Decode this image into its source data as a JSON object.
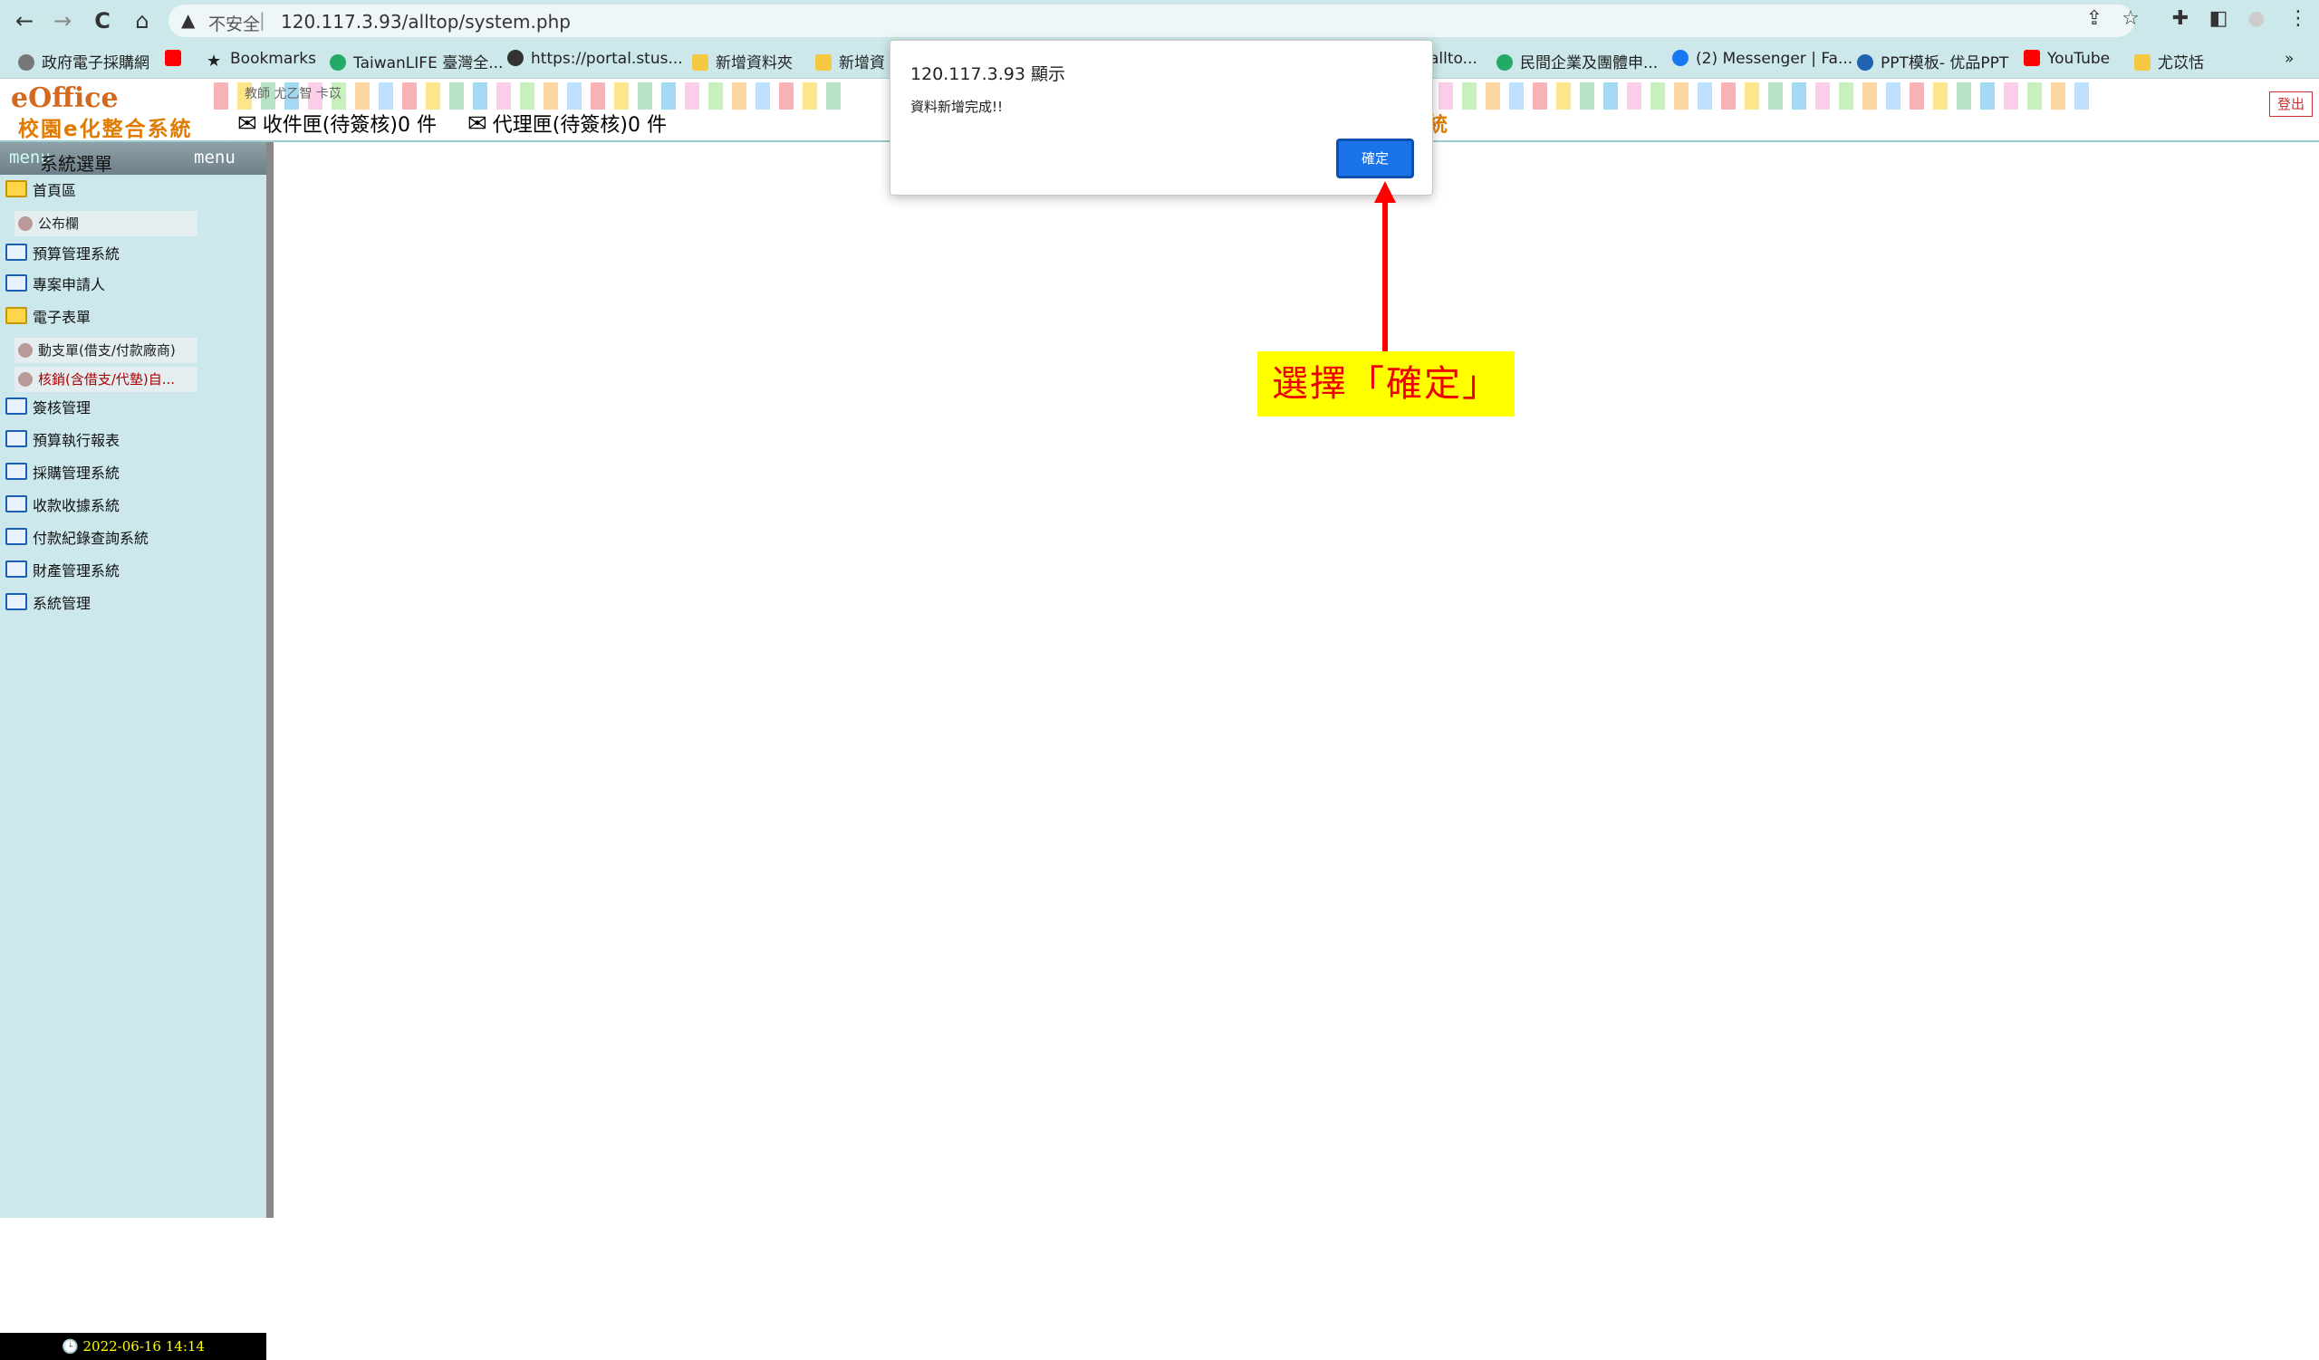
{
  "browser": {
    "back_icon": "←",
    "forward_icon": "→",
    "reload_icon": "C",
    "home_icon": "⌂",
    "security_warning_icon": "▲",
    "insecure_label": "不安全",
    "separator": "|",
    "url": "120.117.3.93/alltop/system.php",
    "icons": [
      "share-icon",
      "star-icon",
      "extensions-icon",
      "sidepanel-icon",
      "profile-icon",
      "menu-icon"
    ]
  },
  "bookmarks": [
    {
      "label": "政府電子採購網",
      "icon": "globe-icon",
      "color": "#777"
    },
    {
      "label": "",
      "icon": "youtube-icon",
      "color": "#f00"
    },
    {
      "label": "Bookmarks",
      "icon": "star-icon",
      "color": "#222"
    },
    {
      "label": "TaiwanLIFE 臺灣全...",
      "icon": "tl-icon",
      "color": "#2a6"
    },
    {
      "label": "https://portal.stus...",
      "icon": "globe-icon",
      "color": "#333"
    },
    {
      "label": "新增資料夾",
      "icon": "folder-icon",
      "color": "#f5c842"
    },
    {
      "label": "新增資",
      "icon": "folder-icon",
      "color": "#f5c842"
    },
    {
      "label": "allto...",
      "icon": "",
      "color": "#000"
    },
    {
      "label": "民間企業及團體申...",
      "icon": "leaf-icon",
      "color": "#2a6"
    },
    {
      "label": "(2) Messenger | Fa...",
      "icon": "facebook-icon",
      "color": "#1877f2"
    },
    {
      "label": "PPT模板- 优品PPT",
      "icon": "ppt-icon",
      "color": "#1e62b0"
    },
    {
      "label": "YouTube",
      "icon": "youtube-icon",
      "color": "#f00"
    },
    {
      "label": "尤苡恬",
      "icon": "folder-icon",
      "color": "#f5c842"
    },
    {
      "label": "»",
      "icon": "",
      "color": "#222"
    }
  ],
  "app": {
    "logo_main": "eOffice",
    "logo_sub": "校園e化整合系統",
    "user_tag": "教師 尤乙智 卡苡",
    "inbox_label": "收件匣(待簽核)0 件",
    "proxy_label": "代理匣(待簽核)0 件",
    "overlap_char": "統",
    "logout_label": "登出",
    "strip_colors": [
      "#f8b4b4",
      "#fde68a",
      "#b7e4c7",
      "#a5d8f3",
      "#fbcfe8",
      "#c7f0bd",
      "#ffd6a5",
      "#bde0fe"
    ]
  },
  "sidebar": {
    "header_ghost": "menu",
    "title": "系統選單",
    "menu_label": "menu",
    "items": [
      {
        "label": "首頁區",
        "type": "folder",
        "open": true
      },
      {
        "label": "公布欄",
        "type": "sub",
        "red": false
      },
      {
        "label": "預算管理系統",
        "type": "folder",
        "open": false
      },
      {
        "label": "專案申請人",
        "type": "folder",
        "open": false
      },
      {
        "label": "電子表單",
        "type": "folder",
        "open": true
      },
      {
        "label": "動支單(借支/付款廠商)",
        "type": "sub",
        "red": false
      },
      {
        "label": "核銷(含借支/代墊)自...",
        "type": "sub",
        "red": true
      },
      {
        "label": "簽核管理",
        "type": "folder",
        "open": false
      },
      {
        "label": "預算執行報表",
        "type": "folder",
        "open": false
      },
      {
        "label": "採購管理系統",
        "type": "folder",
        "open": false
      },
      {
        "label": "收款收據系統",
        "type": "folder",
        "open": false
      },
      {
        "label": "付款紀錄查詢系統",
        "type": "folder",
        "open": false
      },
      {
        "label": "財產管理系統",
        "type": "folder",
        "open": false
      },
      {
        "label": "系統管理",
        "type": "folder",
        "open": false
      }
    ],
    "datetime": "2022-06-16 14:14"
  },
  "dialog": {
    "title": "120.117.3.93 顯示",
    "message": "資料新增完成!!",
    "ok_label": "確定"
  },
  "annotation": {
    "text": "選擇「確定」"
  }
}
